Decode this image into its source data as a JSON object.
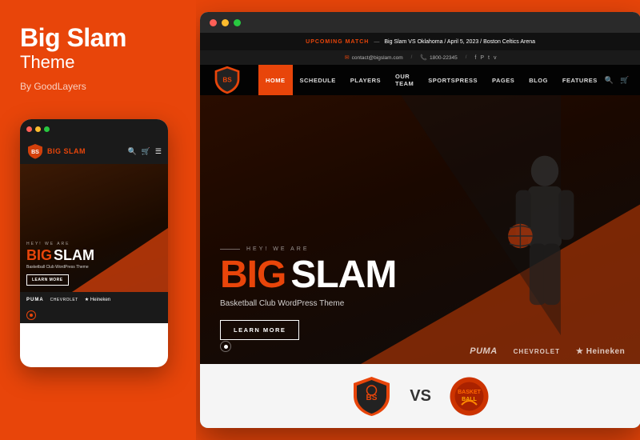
{
  "theme": {
    "title": "Big Slam",
    "subtitle": "Theme",
    "by": "By GoodLayers"
  },
  "colors": {
    "accent": "#e8450a",
    "dark": "#1a1a1a",
    "white": "#ffffff"
  },
  "announcement": {
    "label": "UPCOMING MATCH",
    "dash": "—",
    "text": "Big Slam VS Oklahoma / April 5, 2023 / Boston Celtics Arena"
  },
  "contact": {
    "email": "contact@bigslam.com",
    "phone": "1800-22345"
  },
  "nav": {
    "links": [
      "HOME",
      "SCHEDULE",
      "PLAYERS",
      "OUR TEAM",
      "SPORTSPRESS",
      "PAGES",
      "BLOG",
      "FEATURES"
    ],
    "active": "HOME"
  },
  "hero": {
    "hey_we_are": "HEY! WE ARE",
    "big": "BIG",
    "slam": "SLAM",
    "tagline": "Basketball Club WordPress Theme",
    "cta": "LEARN MORE"
  },
  "sponsors": {
    "items": [
      "PUMA",
      "CHEVROLET",
      "★ Heineken"
    ]
  },
  "mobile": {
    "logo_text_big": "BIG",
    "logo_text_slam": "SLAM",
    "hey": "HEY! WE ARE",
    "big": "BIG",
    "slam": "SLAM",
    "tagline": "Basketball Club WordPress Theme",
    "cta": "LEARN MORE",
    "sponsors": [
      "PUMA",
      "CHEVROLET",
      "★ Heineken"
    ]
  },
  "vs_section": {
    "vs_text": "VS"
  }
}
